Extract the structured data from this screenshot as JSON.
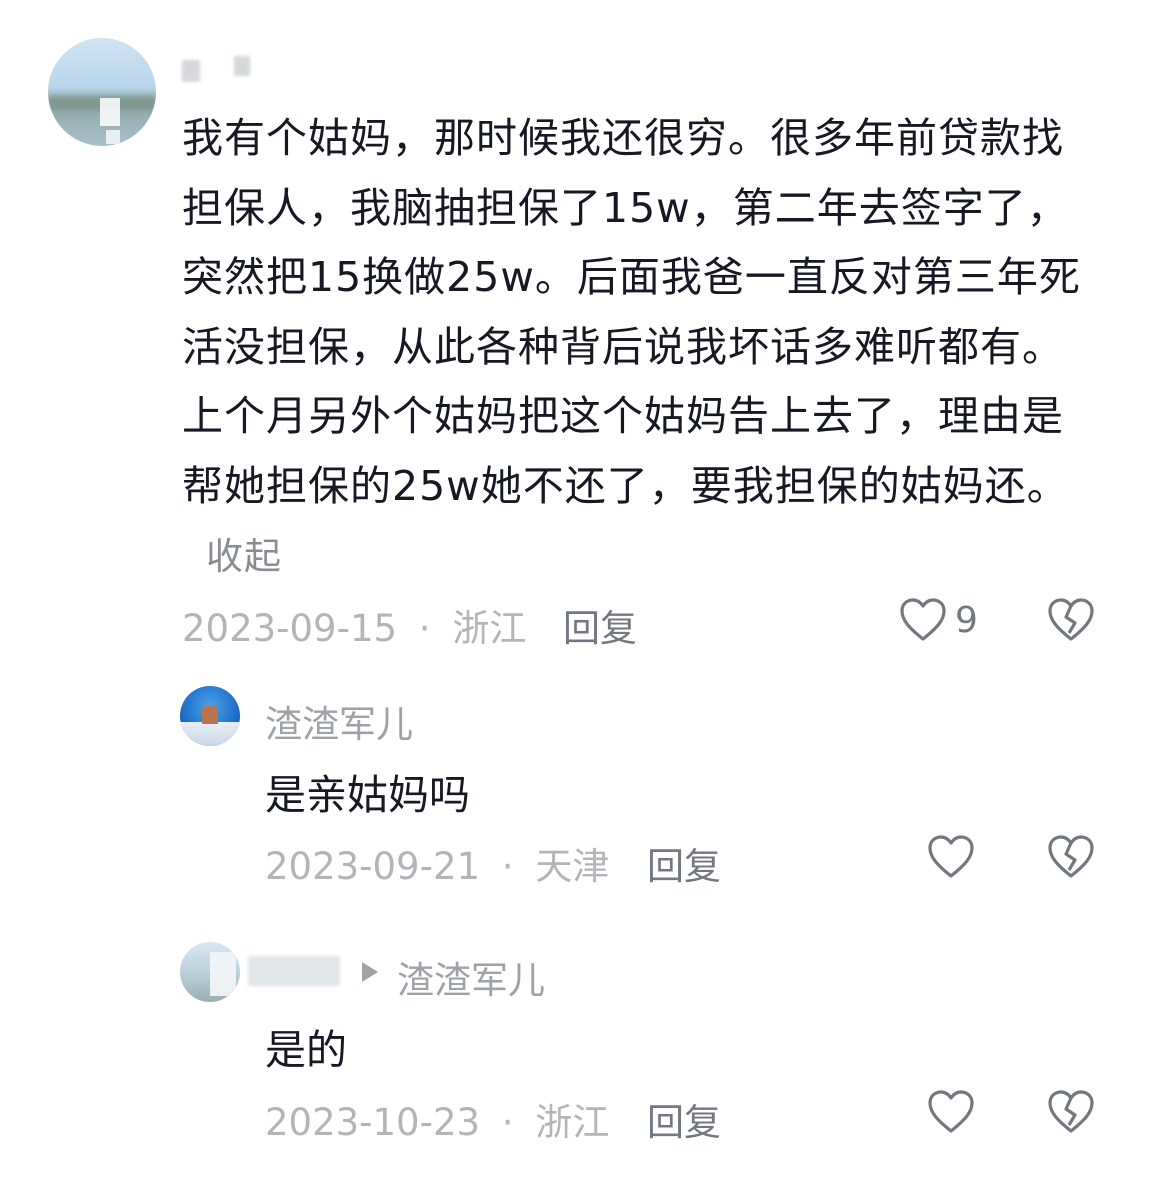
{
  "comment": {
    "text": "我有个姑妈，那时候我还很穷。很多年前贷款找担保人，我脑抽担保了15w，第二年去签字了，突然把15换做25w。后面我爸一直反对第三年死活没担保，从此各种背后说我坏话多难听都有。上个月另外个姑妈把这个姑妈告上去了，理由是帮她担保的25w她不还了，要我担保的姑妈还。",
    "collapse_label": "收起",
    "date": "2023-09-15",
    "location": "浙江",
    "reply_label": "回复",
    "like_count": "9"
  },
  "replies": [
    {
      "username": "渣渣军儿",
      "text": "是亲姑妈吗",
      "date": "2023-09-21",
      "location": "天津",
      "reply_label": "回复"
    },
    {
      "reply_to": "渣渣军儿",
      "text": "是的",
      "date": "2023-10-23",
      "location": "浙江",
      "reply_label": "回复"
    }
  ],
  "separator": "·",
  "icons": {
    "like": "heart-outline-icon",
    "dislike": "broken-heart-icon",
    "reply_to": "triangle-right-icon"
  },
  "colors": {
    "text": "#161823",
    "meta": "#b3b5ba",
    "action": "#737780"
  }
}
